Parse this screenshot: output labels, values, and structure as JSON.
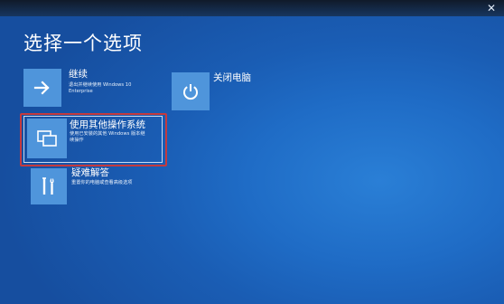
{
  "window": {
    "close_symbol": "✕"
  },
  "page": {
    "title": "选择一个选项"
  },
  "options": [
    {
      "id": "continue",
      "icon": "arrow-right-icon",
      "title": "继续",
      "desc_line1": "退出并继续使用 Windows 10",
      "desc_line2": "Enterprise"
    },
    {
      "id": "shutdown",
      "icon": "power-icon",
      "title": "关闭电脑"
    },
    {
      "id": "other-os",
      "icon": "windows-stack-icon",
      "title": "使用其他操作系统",
      "desc_line1": "使用已安装的其他 Windows 版本继",
      "desc_line2": "续操作"
    },
    {
      "id": "troubleshoot",
      "icon": "tools-icon",
      "title": "疑难解答",
      "desc_line1": "重置你的电脑或查看高级选项"
    }
  ],
  "colors": {
    "background": "#1a5db4",
    "tile": "#4f95db",
    "highlight_border": "#c43a3e"
  }
}
